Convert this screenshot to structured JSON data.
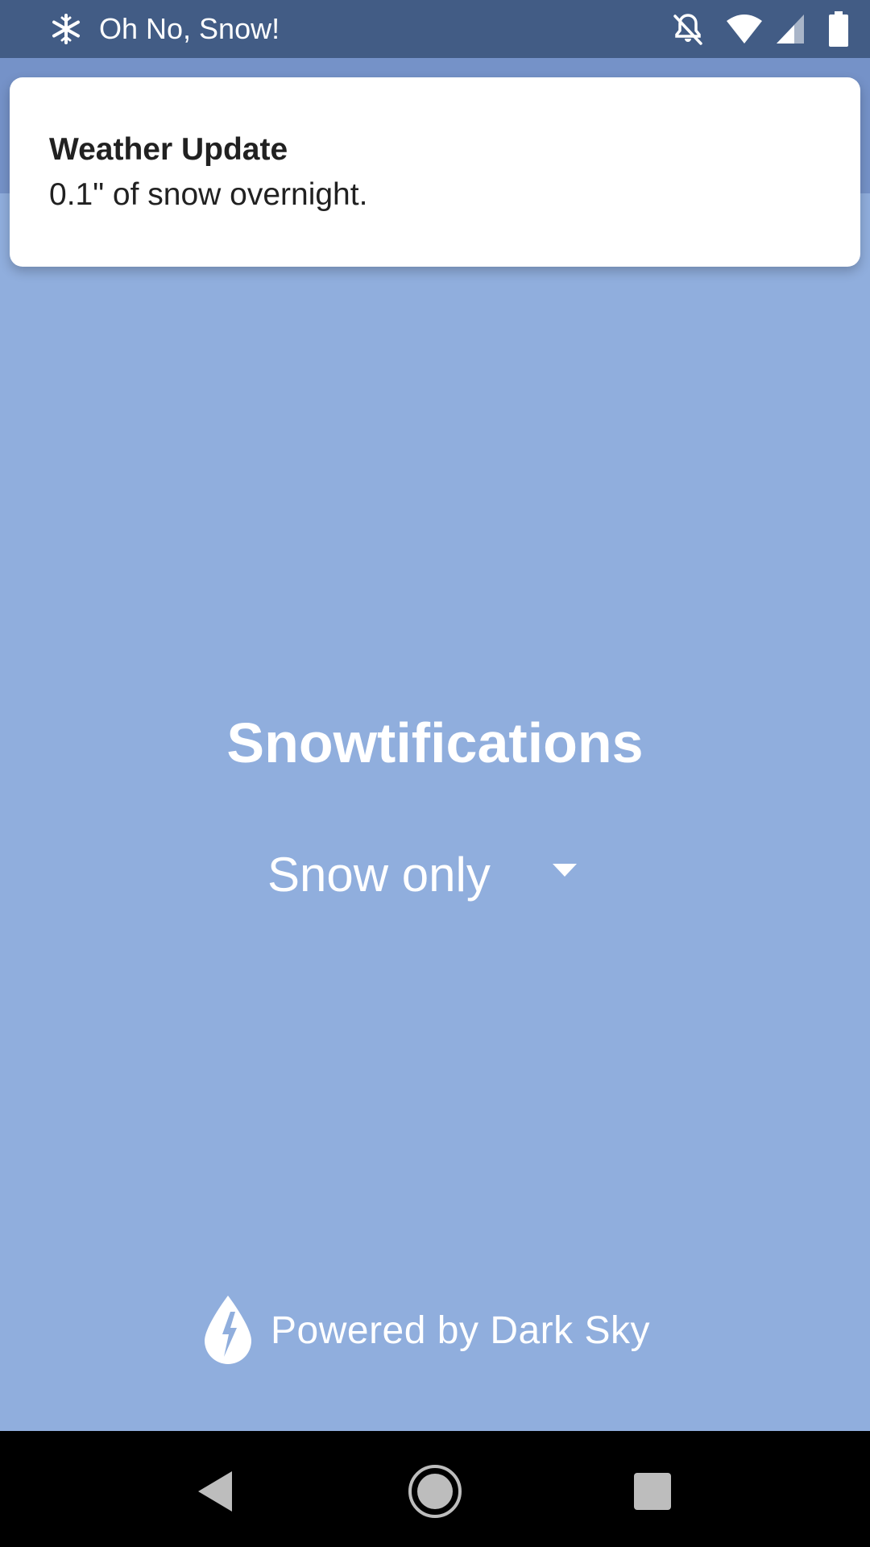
{
  "status_bar": {
    "app_icon": "snowflake-icon",
    "app_title": "Oh No, Snow!",
    "icons": [
      "notifications-off-icon",
      "wifi-icon",
      "cell-signal-icon",
      "battery-icon"
    ]
  },
  "notification": {
    "title": "Weather Update",
    "text": "0.1\" of snow overnight."
  },
  "main": {
    "title": "Snowtifications",
    "dropdown": {
      "selected": "Snow only",
      "icon": "dropdown-arrow-icon"
    }
  },
  "footer": {
    "logo": "dark-sky-logo",
    "powered_label": "Powered by Dark Sky"
  },
  "nav_bar": {
    "buttons": [
      "back-icon",
      "home-icon",
      "recents-icon"
    ]
  },
  "colors": {
    "status_bar": "#425c85",
    "app_bar": "#7592c8",
    "background": "#90aedd",
    "card": "#ffffff",
    "text_on_bg": "#ffffff"
  }
}
